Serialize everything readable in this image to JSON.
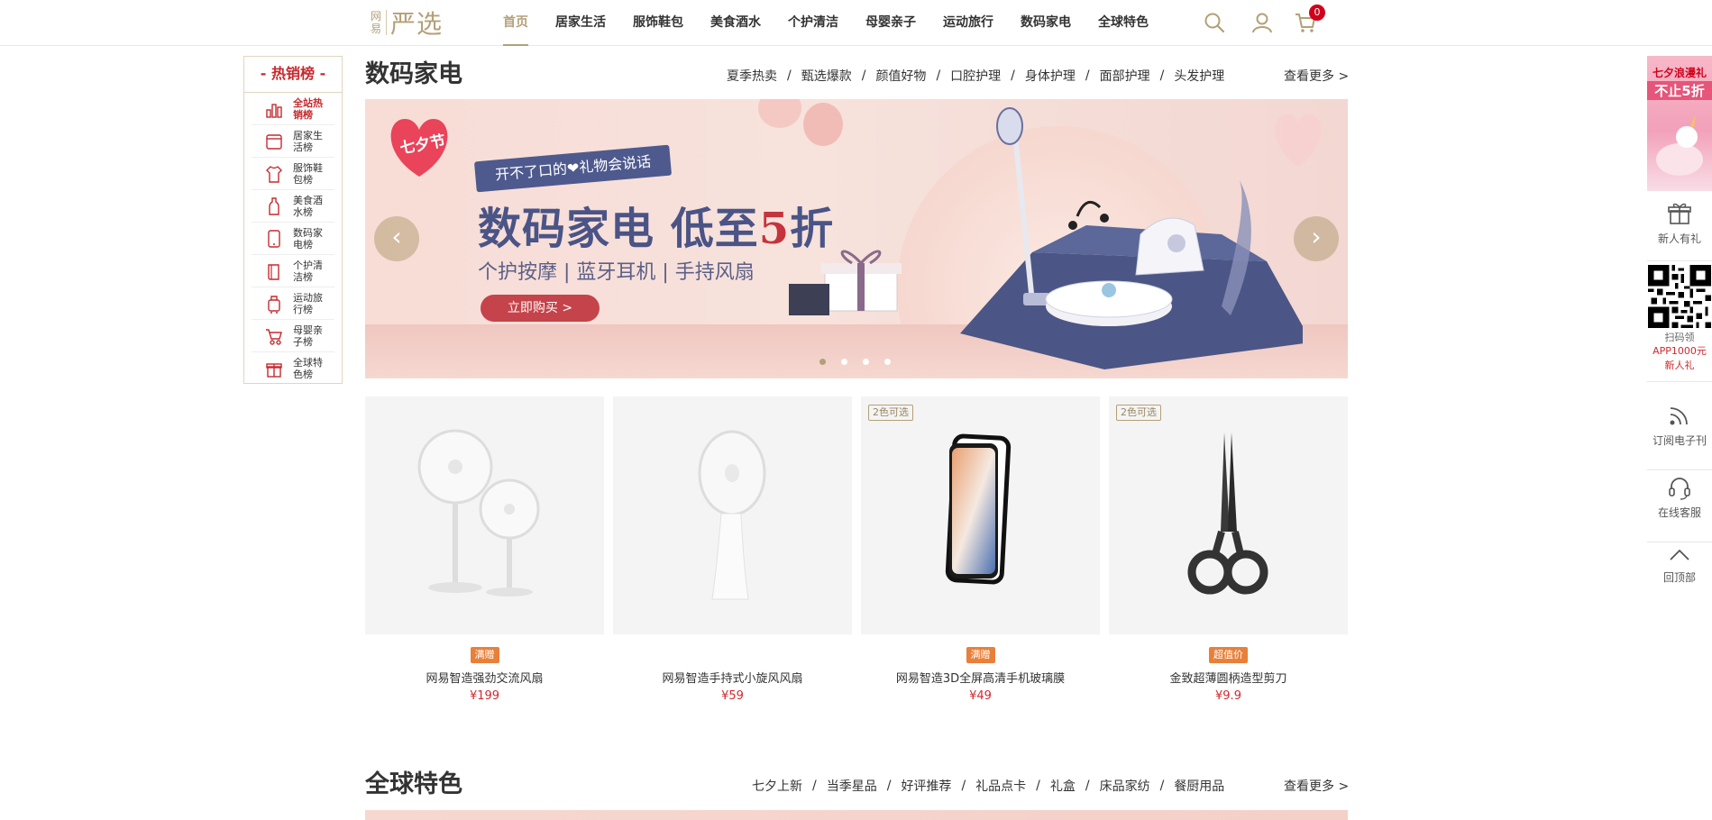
{
  "header": {
    "logo_small": "网易",
    "logo_big": "严选",
    "nav": [
      "首页",
      "居家生活",
      "服饰鞋包",
      "美食酒水",
      "个护清洁",
      "母婴亲子",
      "运动旅行",
      "数码家电",
      "全球特色"
    ],
    "active_nav": "首页",
    "icons": [
      "search-icon",
      "user-icon",
      "cart-icon"
    ],
    "cart_count": "0"
  },
  "ranking": {
    "title": "- 热销榜 -",
    "items": [
      {
        "label": "全站热销榜",
        "icon": "chart-icon",
        "active": true
      },
      {
        "label": "居家生活榜",
        "icon": "home-icon"
      },
      {
        "label": "服饰鞋包榜",
        "icon": "shirt-icon"
      },
      {
        "label": "美食酒水榜",
        "icon": "bottle-icon"
      },
      {
        "label": "数码家电榜",
        "icon": "phone-icon"
      },
      {
        "label": "个护清洁榜",
        "icon": "towel-icon"
      },
      {
        "label": "运动旅行榜",
        "icon": "luggage-icon"
      },
      {
        "label": "母婴亲子榜",
        "icon": "stroller-icon"
      },
      {
        "label": "全球特色榜",
        "icon": "gift-icon"
      }
    ]
  },
  "section1": {
    "title": "数码家电",
    "tags": [
      "夏季热卖",
      "甄选爆款",
      "颜值好物",
      "口腔护理",
      "身体护理",
      "面部护理",
      "头发护理"
    ],
    "more": "查看更多 >",
    "banner": {
      "badge": "七夕节",
      "ribbon": "开不了口的❤礼物会说话",
      "headline_main": "数码家电 低至",
      "headline_highlight": "5",
      "headline_tail": "折",
      "subline": "个护按摩 | 蓝牙耳机 | 手持风扇",
      "button": "立即购买 >",
      "prev": "‹",
      "next": "›",
      "slide_count": 4,
      "active_slide": 0
    },
    "products": [
      {
        "name": "网易智造强劲交流风扇",
        "price": "¥199",
        "badge": "满赠",
        "badge_color": "#e8803a",
        "color_tag": ""
      },
      {
        "name": "网易智造手持式小旋风风扇",
        "price": "¥59",
        "badge": "",
        "badge_color": "",
        "color_tag": ""
      },
      {
        "name": "网易智造3D全屏高清手机玻璃膜",
        "price": "¥49",
        "badge": "满赠",
        "badge_color": "#e8803a",
        "color_tag": "2色可选"
      },
      {
        "name": "金致超薄圆柄造型剪刀",
        "price": "¥9.9",
        "badge": "超值价",
        "badge_color": "#e8803a",
        "color_tag": "2色可选"
      }
    ]
  },
  "section2": {
    "title": "全球特色",
    "tags": [
      "七夕上新",
      "当季星品",
      "好评推荐",
      "礼品点卡",
      "礼盒",
      "床品家纺",
      "餐厨用品"
    ],
    "more": "查看更多 >"
  },
  "right_sidebar": {
    "promo_line1": "七夕浪漫礼",
    "promo_line2": "不止5折",
    "gift_label": "新人有礼",
    "qr_line1": "扫码领",
    "qr_line2": "APP1000元",
    "qr_line3": "新人礼",
    "rss_label": "订阅电子刊",
    "service_label": "在线客服",
    "top_label": "回顶部"
  },
  "colors": {
    "accent": "#b4a078",
    "red": "#d4282d",
    "banner_navy": "#4a5486"
  }
}
